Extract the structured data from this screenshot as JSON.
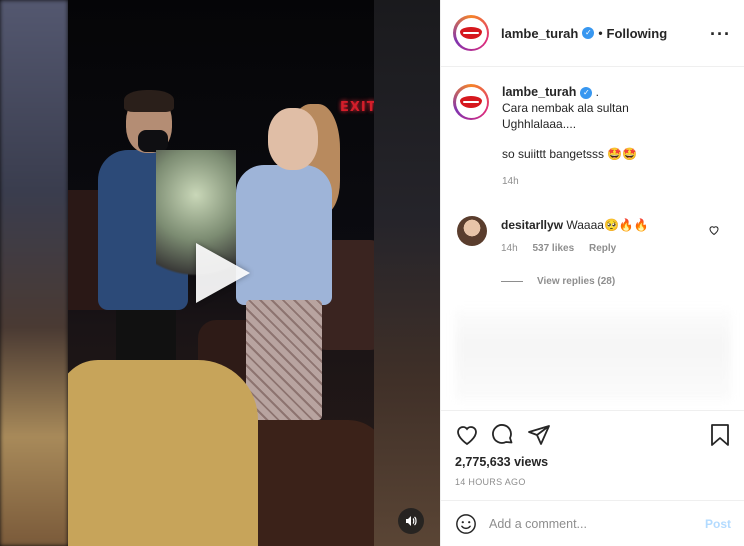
{
  "header": {
    "username": "lambe_turah",
    "follow_status": "Following",
    "separator": "•"
  },
  "caption": {
    "username": "lambe_turah",
    "suffix": " .",
    "text": "Cara nembak ala sultan\nUghhlalaaa....",
    "text2": "so suiittt bangetsss 🤩🤩",
    "time": "14h"
  },
  "comments": [
    {
      "username": "desitarllyw",
      "text": "Waaaa🥺🔥🔥",
      "time": "14h",
      "likes": "537 likes",
      "reply_label": "Reply"
    }
  ],
  "view_replies": "View replies (28)",
  "video": {
    "overlay_sign": "EXIT"
  },
  "stats": {
    "views": "2,775,633 views",
    "posted": "14 HOURS AGO"
  },
  "add_comment": {
    "placeholder": "Add a comment...",
    "post_label": "Post"
  },
  "colors": {
    "accent_blue": "#3897f0",
    "post_disabled": "#b3dbff",
    "muted": "#8e8e8e"
  }
}
